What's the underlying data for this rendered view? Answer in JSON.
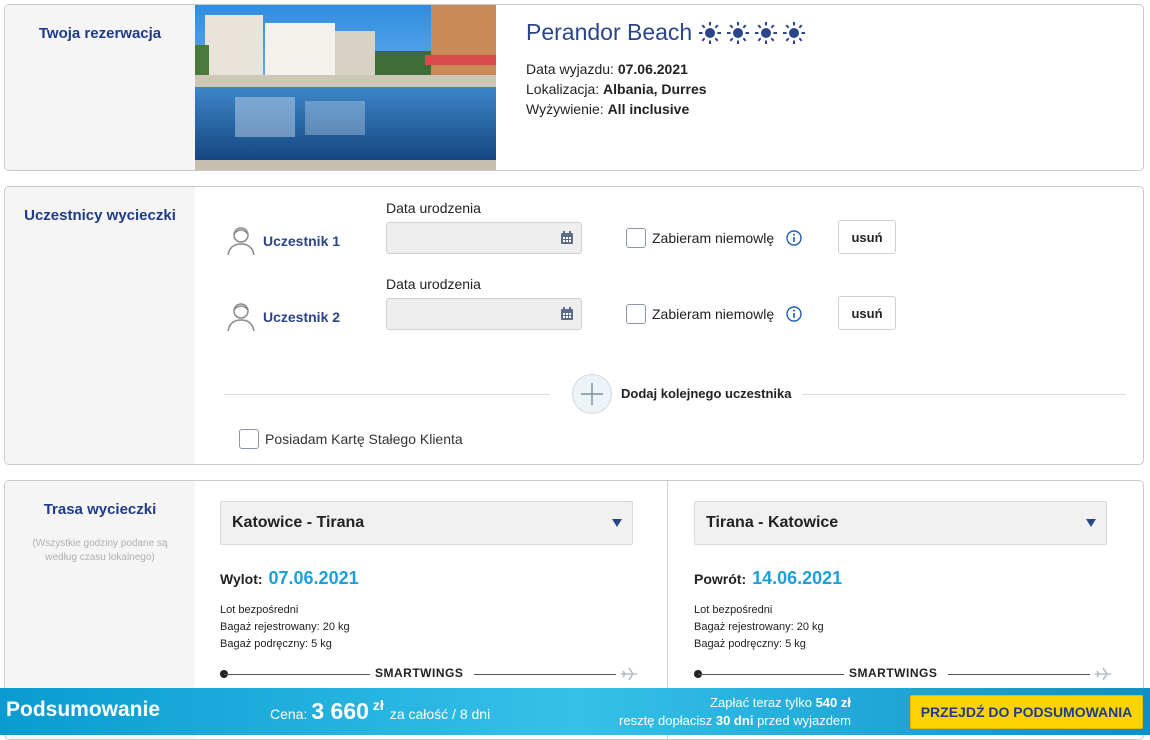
{
  "booking": {
    "section_title": "Twoja rezerwacja",
    "hotel_name": "Perandor Beach",
    "stars": 4,
    "departure_label": "Data wyjazdu:",
    "departure_value": "07.06.2021",
    "location_label": "Lokalizacja:",
    "location_value": "Albania, Durres",
    "board_label": "Wyżywienie:",
    "board_value": "All inclusive"
  },
  "participants": {
    "section_title": "Uczestnicy wycieczki",
    "dob_label": "Data urodzenia",
    "infant_label": "Zabieram niemowlę",
    "remove_label": "usuń",
    "items": [
      {
        "name": "Uczestnik 1",
        "dob": ""
      },
      {
        "name": "Uczestnik 2",
        "dob": ""
      }
    ],
    "add_label": "Dodaj kolejnego uczestnika",
    "loyalty_label": "Posiadam Kartę Stałego Klienta"
  },
  "route": {
    "section_title": "Trasa wycieczki",
    "note": "(Wszystkie godziny podane są według czasu lokalnego)",
    "outbound": {
      "select": "Katowice - Tirana",
      "date_label": "Wylot:",
      "date_value": "07.06.2021",
      "flight_type": "Lot bezpośredni",
      "checked_bag": "Bagaż rejestrowany: 20 kg",
      "hand_bag": "Bagaż podręczny: 5 kg",
      "airline": "SMARTWINGS"
    },
    "return": {
      "select": "Tirana - Katowice",
      "date_label": "Powrót:",
      "date_value": "14.06.2021",
      "flight_type": "Lot bezpośredni",
      "checked_bag": "Bagaż rejestrowany: 20 kg",
      "hand_bag": "Bagaż podręczny: 5 kg",
      "airline": "SMARTWINGS"
    }
  },
  "summary": {
    "title": "Podsumowanie",
    "price_label": "Cena:",
    "price_value": "3 660",
    "currency": "zł",
    "price_suffix": "za całość / 8 dni",
    "pay_now_prefix": "Zapłać teraz tylko",
    "pay_now_value": "540 zł",
    "rest_prefix": "resztę dopłacisz",
    "rest_value": "30 dni",
    "rest_suffix": "przed wyjazdem",
    "cta_label": "PRZEJDŹ DO PODSUMOWANIA"
  },
  "colors": {
    "brand_navy": "#2a4588",
    "accent_blue": "#1ba1d8",
    "cta_yellow": "#fdd400"
  }
}
